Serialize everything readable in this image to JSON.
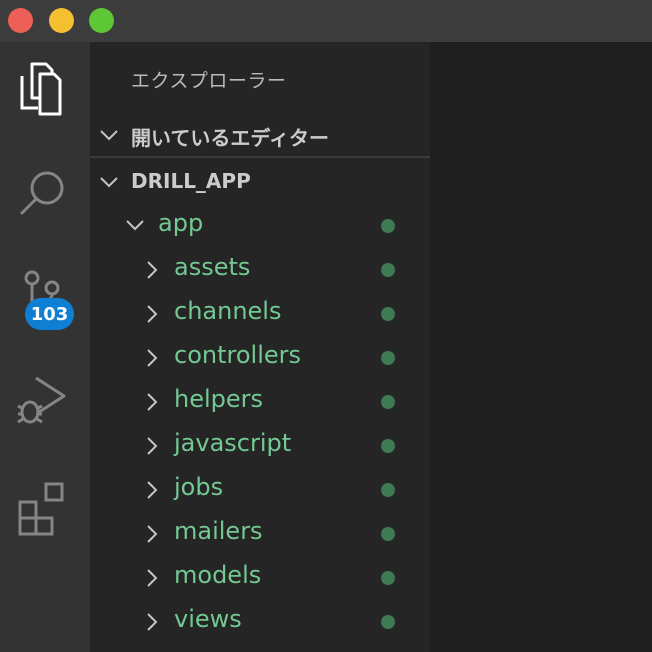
{
  "sidebar": {
    "title": "エクスプローラー",
    "open_editors": "開いているエディター",
    "project": "DRILL_APP"
  },
  "tree": {
    "root": "app",
    "folders": [
      {
        "label": "assets"
      },
      {
        "label": "channels"
      },
      {
        "label": "controllers"
      },
      {
        "label": "helpers"
      },
      {
        "label": "javascript"
      },
      {
        "label": "jobs"
      },
      {
        "label": "mailers"
      },
      {
        "label": "models"
      },
      {
        "label": "views"
      }
    ]
  },
  "activity": {
    "scm_badge": "103"
  },
  "colors": {
    "accent": "#0e7fd3",
    "folder_text": "#73c991",
    "modified_dot": "#3f7a55"
  }
}
